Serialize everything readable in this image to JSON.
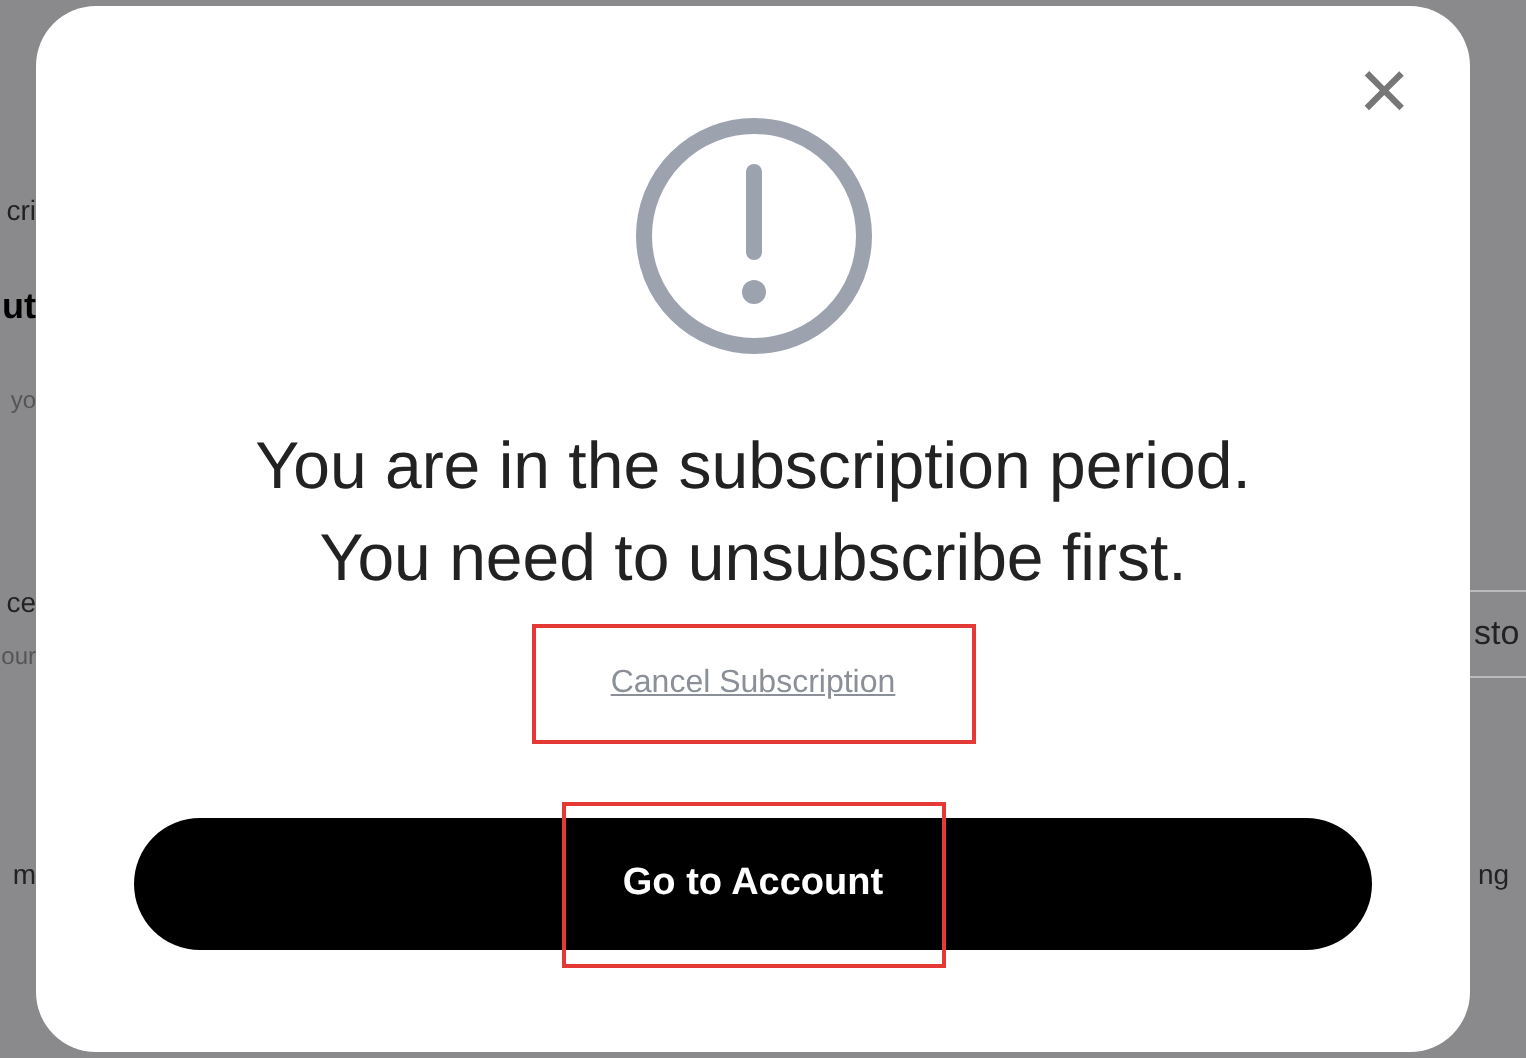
{
  "background": {
    "left_fragments": [
      {
        "text": "cri",
        "kind": "label"
      },
      {
        "text": "ut",
        "kind": "heading"
      },
      {
        "text": "yo",
        "kind": "hint"
      },
      {
        "text": "ce",
        "kind": "label"
      },
      {
        "text": "our",
        "kind": "hint"
      },
      {
        "text": "m",
        "kind": "label"
      }
    ],
    "right_fragments": [
      {
        "text": "sto",
        "kind": "button"
      },
      {
        "text": "ng",
        "kind": "label"
      }
    ]
  },
  "dialog": {
    "close": "×",
    "message_lines": [
      "You are in the subscription period.",
      "You need to unsubscribe first."
    ],
    "link": {
      "label": "Cancel Subscription",
      "highlighted": true
    },
    "button": {
      "label": "Go to Account",
      "highlighted": true
    }
  }
}
